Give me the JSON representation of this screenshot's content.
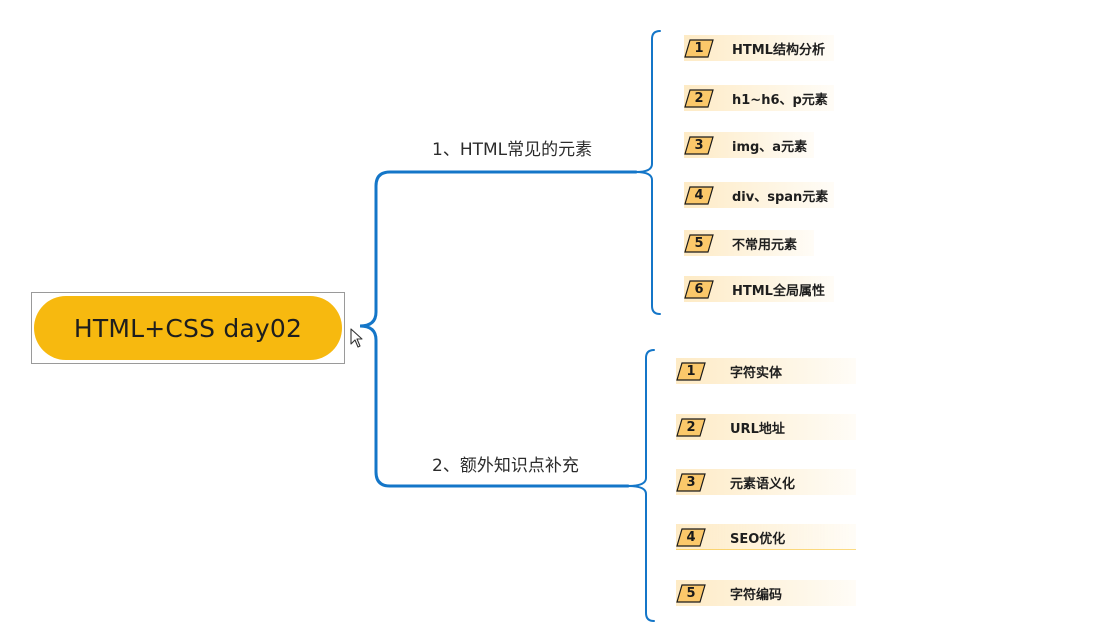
{
  "root": {
    "label": "HTML+CSS day02"
  },
  "branches": [
    {
      "label": "1、HTML常见的元素",
      "items": [
        {
          "num": "1",
          "label": "HTML结构分析"
        },
        {
          "num": "2",
          "label": "h1~h6、p元素"
        },
        {
          "num": "3",
          "label": "img、a元素"
        },
        {
          "num": "4",
          "label": "div、span元素"
        },
        {
          "num": "5",
          "label": "不常用元素"
        },
        {
          "num": "6",
          "label": "HTML全局属性"
        }
      ]
    },
    {
      "label": "2、额外知识点补充",
      "items": [
        {
          "num": "1",
          "label": "字符实体"
        },
        {
          "num": "2",
          "label": "URL地址"
        },
        {
          "num": "3",
          "label": "元素语义化"
        },
        {
          "num": "4",
          "label": "SEO优化"
        },
        {
          "num": "5",
          "label": "字符编码"
        }
      ]
    }
  ],
  "colors": {
    "connector": "#1476c8",
    "root_fill": "#f7b90f",
    "tag_fill": "#fbc86a",
    "tag_stroke": "#1a1a1a"
  }
}
